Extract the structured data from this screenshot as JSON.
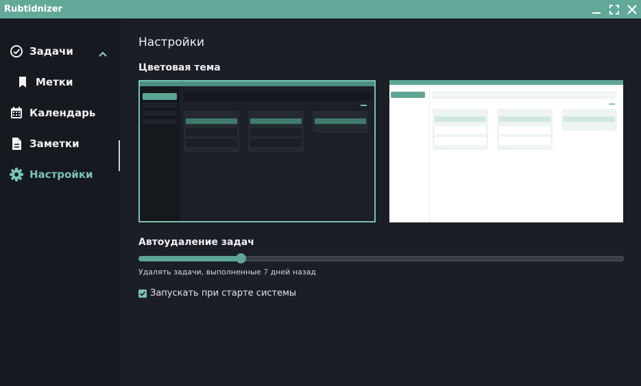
{
  "window": {
    "title": "Rubtidnizer",
    "controls": [
      "minimize-icon",
      "maximize-icon",
      "close-icon"
    ]
  },
  "sidebar": {
    "items": [
      {
        "label": "Задачи",
        "icon": "check-circle-icon",
        "expanded": true
      },
      {
        "label": "Метки",
        "icon": "bookmark-icon",
        "child": true
      },
      {
        "label": "Календарь",
        "icon": "calendar-icon"
      },
      {
        "label": "Заметки",
        "icon": "document-icon"
      },
      {
        "label": "Настройки",
        "icon": "gear-icon",
        "active": true
      }
    ]
  },
  "settings": {
    "title": "Настройки",
    "theme": {
      "title": "Цветовая тема",
      "options": [
        "dark",
        "light"
      ],
      "selected": "dark"
    },
    "autodelete": {
      "title": "Автоудаление задач",
      "hint_prefix": "Удалять задачи, выполненные ",
      "days": "7",
      "hint_suffix": " дней назад",
      "slider_fraction": 0.21
    },
    "autostart": {
      "label": "Запускать при старте системы",
      "checked": true
    }
  },
  "colors": {
    "accent": "#5ea695",
    "accent_light": "#7ac3b3",
    "titlebar": "#63a99a",
    "background": "#1b1e26",
    "sidebar": "#16191f"
  }
}
